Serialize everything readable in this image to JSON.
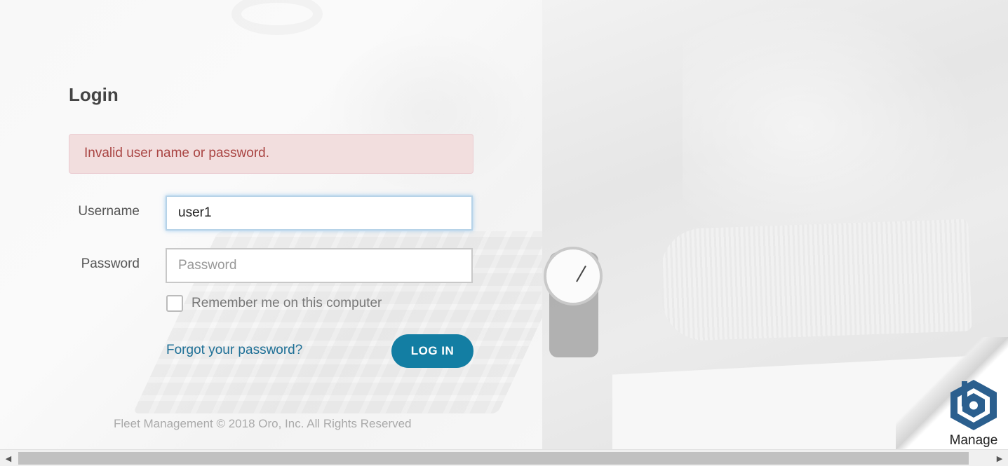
{
  "login": {
    "title": "Login",
    "error_message": "Invalid user name or password.",
    "username_label": "Username",
    "username_value": "user1",
    "password_label": "Password",
    "password_placeholder": "Password",
    "remember_label": "Remember me on this computer",
    "remember_checked": false,
    "forgot_link": "Forgot your password?",
    "submit_label": "LOG IN"
  },
  "footer": {
    "copyright": "Fleet Management © 2018 Oro, Inc. All Rights Reserved"
  },
  "brand": {
    "label": "Manage",
    "logo_icon": "hexagon-b-logo-icon",
    "color": "#2b5f8e"
  },
  "colors": {
    "primary_button": "#137ea3",
    "link": "#1d6f96",
    "error_bg": "#f2dede",
    "error_text": "#a94442"
  },
  "scrollbar": {
    "left_arrow": "◀",
    "right_arrow": "▶"
  }
}
